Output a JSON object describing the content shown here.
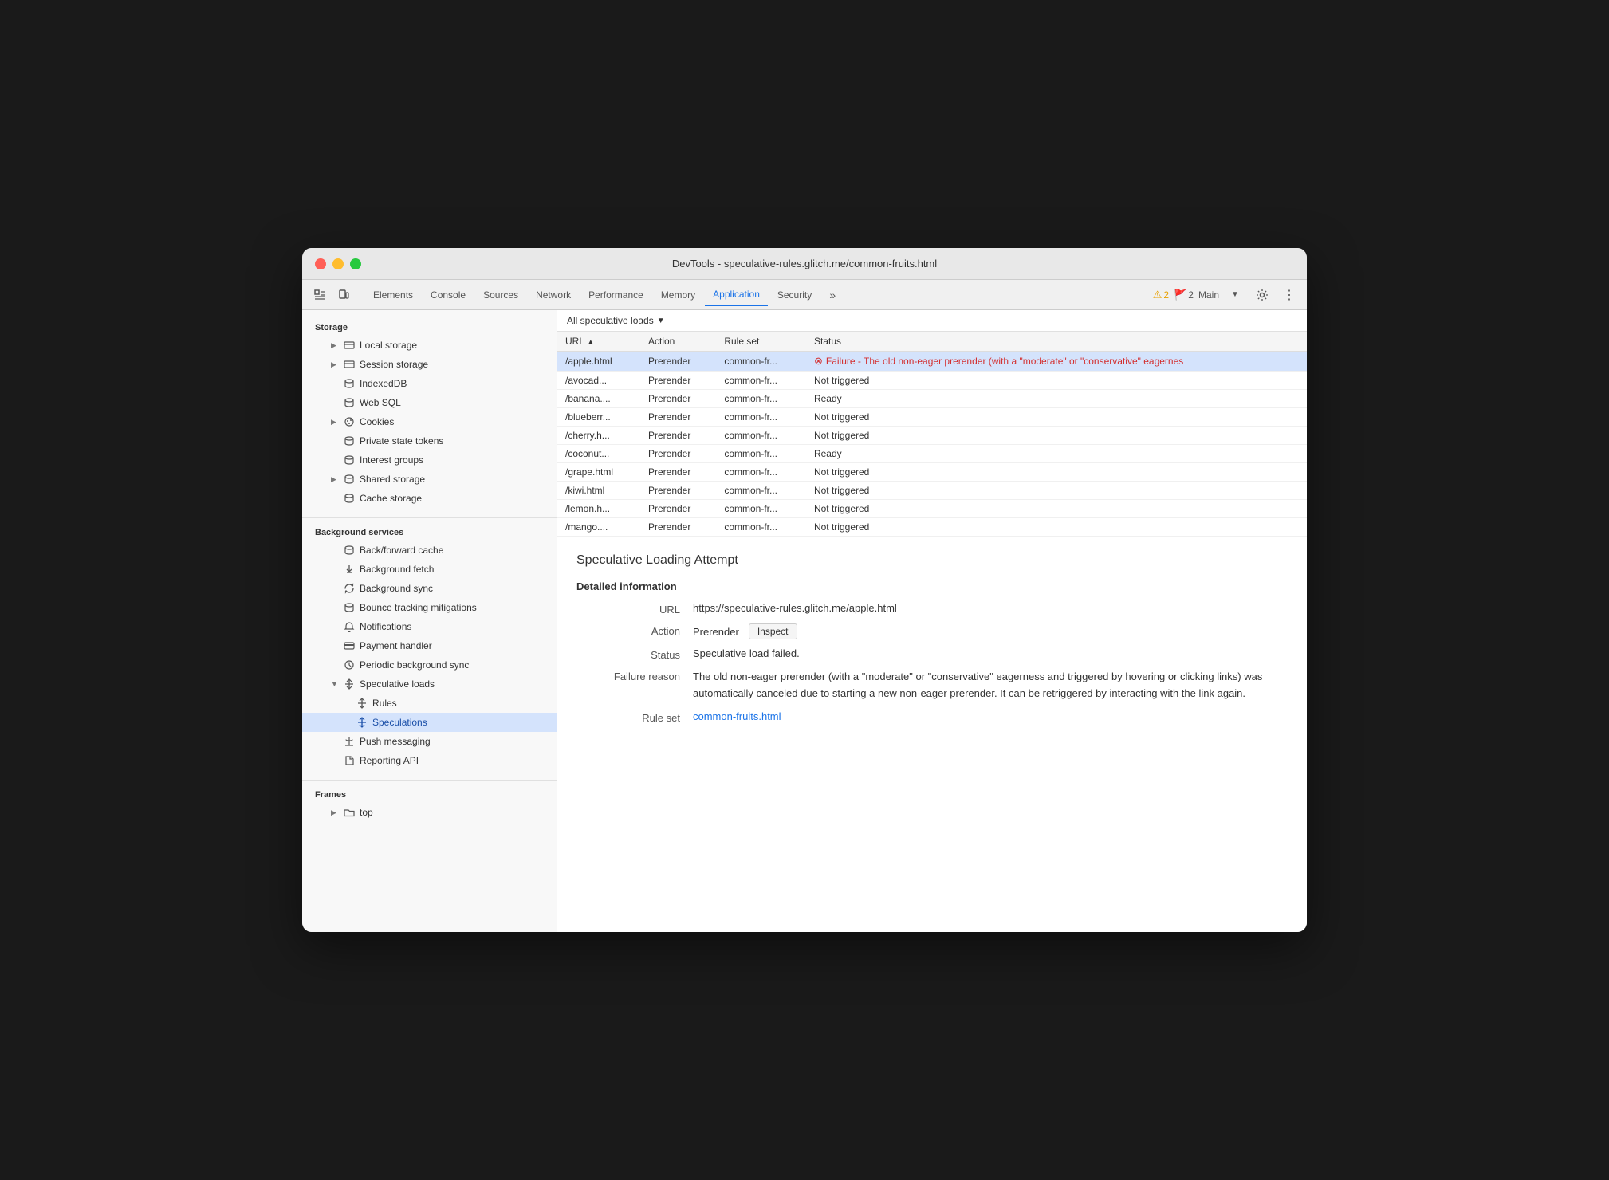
{
  "window": {
    "title": "DevTools - speculative-rules.glitch.me/common-fruits.html"
  },
  "toolbar": {
    "tabs": [
      {
        "id": "elements",
        "label": "Elements",
        "active": false
      },
      {
        "id": "console",
        "label": "Console",
        "active": false
      },
      {
        "id": "sources",
        "label": "Sources",
        "active": false
      },
      {
        "id": "network",
        "label": "Network",
        "active": false
      },
      {
        "id": "performance",
        "label": "Performance",
        "active": false
      },
      {
        "id": "memory",
        "label": "Memory",
        "active": false
      },
      {
        "id": "application",
        "label": "Application",
        "active": true
      },
      {
        "id": "security",
        "label": "Security",
        "active": false
      }
    ],
    "warnings_count": "2",
    "errors_count": "2",
    "main_label": "Main"
  },
  "sidebar": {
    "storage_header": "Storage",
    "items_storage": [
      {
        "id": "local-storage",
        "label": "Local storage",
        "icon": "grid",
        "indent": 1,
        "expandable": true
      },
      {
        "id": "session-storage",
        "label": "Session storage",
        "icon": "grid",
        "indent": 1,
        "expandable": true
      },
      {
        "id": "indexeddb",
        "label": "IndexedDB",
        "icon": "cylinder",
        "indent": 1
      },
      {
        "id": "web-sql",
        "label": "Web SQL",
        "icon": "cylinder",
        "indent": 1
      },
      {
        "id": "cookies",
        "label": "Cookies",
        "icon": "cookie",
        "indent": 1,
        "expandable": true
      },
      {
        "id": "private-state-tokens",
        "label": "Private state tokens",
        "icon": "cylinder",
        "indent": 1
      },
      {
        "id": "interest-groups",
        "label": "Interest groups",
        "icon": "cylinder",
        "indent": 1
      },
      {
        "id": "shared-storage",
        "label": "Shared storage",
        "icon": "cylinder",
        "indent": 1,
        "expandable": true
      },
      {
        "id": "cache-storage",
        "label": "Cache storage",
        "icon": "cylinder",
        "indent": 1
      }
    ],
    "bg_services_header": "Background services",
    "items_bg": [
      {
        "id": "back-forward-cache",
        "label": "Back/forward cache",
        "icon": "cylinder",
        "indent": 1
      },
      {
        "id": "background-fetch",
        "label": "Background fetch",
        "icon": "arrow-up-down",
        "indent": 1
      },
      {
        "id": "background-sync",
        "label": "Background sync",
        "icon": "refresh",
        "indent": 1
      },
      {
        "id": "bounce-tracking",
        "label": "Bounce tracking mitigations",
        "icon": "cylinder",
        "indent": 1
      },
      {
        "id": "notifications",
        "label": "Notifications",
        "icon": "bell",
        "indent": 1
      },
      {
        "id": "payment-handler",
        "label": "Payment handler",
        "icon": "card",
        "indent": 1
      },
      {
        "id": "periodic-bg-sync",
        "label": "Periodic background sync",
        "icon": "clock",
        "indent": 1
      },
      {
        "id": "speculative-loads",
        "label": "Speculative loads",
        "icon": "arrows",
        "indent": 1,
        "expandable": true,
        "expanded": true
      },
      {
        "id": "rules",
        "label": "Rules",
        "icon": "arrows",
        "indent": 2
      },
      {
        "id": "speculations",
        "label": "Speculations",
        "icon": "arrows",
        "indent": 2,
        "active": true
      },
      {
        "id": "push-messaging",
        "label": "Push messaging",
        "icon": "cloud",
        "indent": 1
      },
      {
        "id": "reporting-api",
        "label": "Reporting API",
        "icon": "doc",
        "indent": 1
      }
    ],
    "frames_header": "Frames",
    "items_frames": [
      {
        "id": "top",
        "label": "top",
        "icon": "folder",
        "indent": 1,
        "expandable": true
      }
    ]
  },
  "filter": {
    "label": "All speculative loads"
  },
  "table": {
    "columns": [
      "URL",
      "Action",
      "Rule set",
      "Status"
    ],
    "rows": [
      {
        "url": "/apple.html",
        "action": "Prerender",
        "ruleset": "common-fr...",
        "status": "Failure - The old non-eager prerender (with a \"moderate\" or \"conservative\" eagernes",
        "status_type": "failure",
        "selected": true
      },
      {
        "url": "/avocad...",
        "action": "Prerender",
        "ruleset": "common-fr...",
        "status": "Not triggered",
        "status_type": "normal"
      },
      {
        "url": "/banana....",
        "action": "Prerender",
        "ruleset": "common-fr...",
        "status": "Ready",
        "status_type": "normal"
      },
      {
        "url": "/blueberr...",
        "action": "Prerender",
        "ruleset": "common-fr...",
        "status": "Not triggered",
        "status_type": "normal"
      },
      {
        "url": "/cherry.h...",
        "action": "Prerender",
        "ruleset": "common-fr...",
        "status": "Not triggered",
        "status_type": "normal"
      },
      {
        "url": "/coconut...",
        "action": "Prerender",
        "ruleset": "common-fr...",
        "status": "Ready",
        "status_type": "normal"
      },
      {
        "url": "/grape.html",
        "action": "Prerender",
        "ruleset": "common-fr...",
        "status": "Not triggered",
        "status_type": "normal"
      },
      {
        "url": "/kiwi.html",
        "action": "Prerender",
        "ruleset": "common-fr...",
        "status": "Not triggered",
        "status_type": "normal"
      },
      {
        "url": "/lemon.h...",
        "action": "Prerender",
        "ruleset": "common-fr...",
        "status": "Not triggered",
        "status_type": "normal"
      },
      {
        "url": "/mango....",
        "action": "Prerender",
        "ruleset": "common-fr...",
        "status": "Not triggered",
        "status_type": "normal"
      }
    ]
  },
  "detail": {
    "title": "Speculative Loading Attempt",
    "section_title": "Detailed information",
    "url_label": "URL",
    "url_value": "https://speculative-rules.glitch.me/apple.html",
    "action_label": "Action",
    "action_value": "Prerender",
    "inspect_label": "Inspect",
    "status_label": "Status",
    "status_value": "Speculative load failed.",
    "failure_reason_label": "Failure reason",
    "failure_reason_value": "The old non-eager prerender (with a \"moderate\" or \"conservative\" eagerness and triggered by hovering or clicking links) was automatically canceled due to starting a new non-eager prerender. It can be retriggered by interacting with the link again.",
    "ruleset_label": "Rule set",
    "ruleset_link_text": "common-fruits.html",
    "ruleset_link_href": "#"
  }
}
